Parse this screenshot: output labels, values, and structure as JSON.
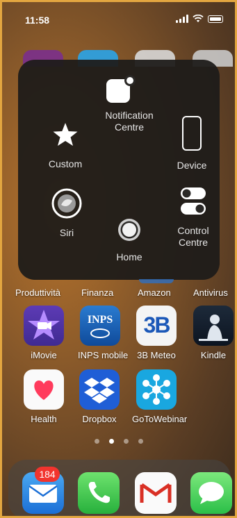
{
  "status_bar": {
    "time": "11:58"
  },
  "assistive_touch": {
    "notification_centre": "Notification\nCentre",
    "custom": "Custom",
    "device": "Device",
    "siri": "Siri",
    "control_centre": "Control\nCentre",
    "home": "Home"
  },
  "folders": {
    "row1": [
      "Produttività",
      "Finanza",
      "Amazon",
      "Antivirus"
    ]
  },
  "apps": {
    "row2": [
      {
        "label": "iMovie",
        "icon": "imovie-icon"
      },
      {
        "label": "INPS mobile",
        "icon": "inps-icon",
        "logo_text": "INPS"
      },
      {
        "label": "3B Meteo",
        "icon": "3b-meteo-icon",
        "logo_text": "3B"
      },
      {
        "label": "Kindle",
        "icon": "kindle-icon"
      }
    ],
    "row3": [
      {
        "label": "Health",
        "icon": "heart-icon"
      },
      {
        "label": "Dropbox",
        "icon": "dropbox-icon"
      },
      {
        "label": "GoToWebinar",
        "icon": "gotowebinar-icon"
      }
    ]
  },
  "page_dots": {
    "count": 4,
    "active": 1
  },
  "dock": {
    "mail_badge": "184",
    "apps": [
      "mail-icon",
      "phone-icon",
      "gmail-icon",
      "messages-icon"
    ]
  },
  "colors": {
    "frame": "#e3a640",
    "badge": "#f2342e"
  }
}
